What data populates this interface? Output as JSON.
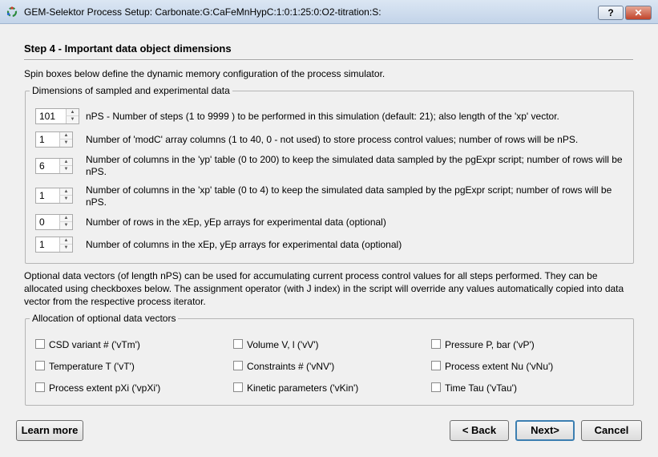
{
  "window": {
    "title": "GEM-Selektor Process Setup:  Carbonate:G:CaFeMnHypC:1:0:1:25:0:O2-titration:S:",
    "help_label": "?",
    "close_label": "✕"
  },
  "step": {
    "title": "Step 4 - Important data object dimensions",
    "intro": "Spin boxes below define the dynamic memory configuration of the process simulator."
  },
  "dimensions": {
    "group_label": "Dimensions of sampled and experimental data",
    "rows": [
      {
        "value": "101",
        "text": "nPS - Number of steps (1 to 9999 ) to be performed in this simulation (default: 21); also length of the 'xp' vector."
      },
      {
        "value": "1",
        "text": "Number of 'modC' array columns (1 to 40, 0 - not used) to store process control values; number of rows will be nPS."
      },
      {
        "value": "6",
        "text": "Number of columns in the 'yp' table (0 to 200) to keep the simulated data sampled by the pgExpr script; number of rows will be nPS."
      },
      {
        "value": "1",
        "text": "Number of columns in the 'xp' table (0 to 4) to keep the simulated data sampled by the pgExpr script; number of rows will be nPS."
      },
      {
        "value": "0",
        "text": "Number of rows in the xEp, yEp arrays for experimental data (optional)"
      },
      {
        "value": "1",
        "text": "Number of columns in the xEp, yEp arrays for experimental data (optional)"
      }
    ]
  },
  "optional_text": "Optional data vectors  (of length nPS) can be used for accumulating current process control values for all steps performed. They can be allocated using checkboxes below. The assignment operator (with J index) in the script will override any values automatically copied into data vector from the respective process iterator.",
  "allocation": {
    "group_label": "Allocation of optional data vectors",
    "items": [
      {
        "label": "CSD variant # ('vTm')",
        "checked": false
      },
      {
        "label": "Volume V, l ('vV')",
        "checked": false
      },
      {
        "label": "Pressure P, bar ('vP')",
        "checked": false
      },
      {
        "label": "Temperature T ('vT')",
        "checked": false
      },
      {
        "label": "Constraints # ('vNV')",
        "checked": false
      },
      {
        "label": "Process extent Nu ('vNu')",
        "checked": false
      },
      {
        "label": "Process extent pXi ('vpXi')",
        "checked": false
      },
      {
        "label": "Kinetic parameters ('vKin')",
        "checked": false
      },
      {
        "label": "Time Tau ('vTau')",
        "checked": false
      }
    ]
  },
  "buttons": {
    "learn_more": "Learn more",
    "back": "< Back",
    "next": "Next>",
    "cancel": "Cancel"
  }
}
